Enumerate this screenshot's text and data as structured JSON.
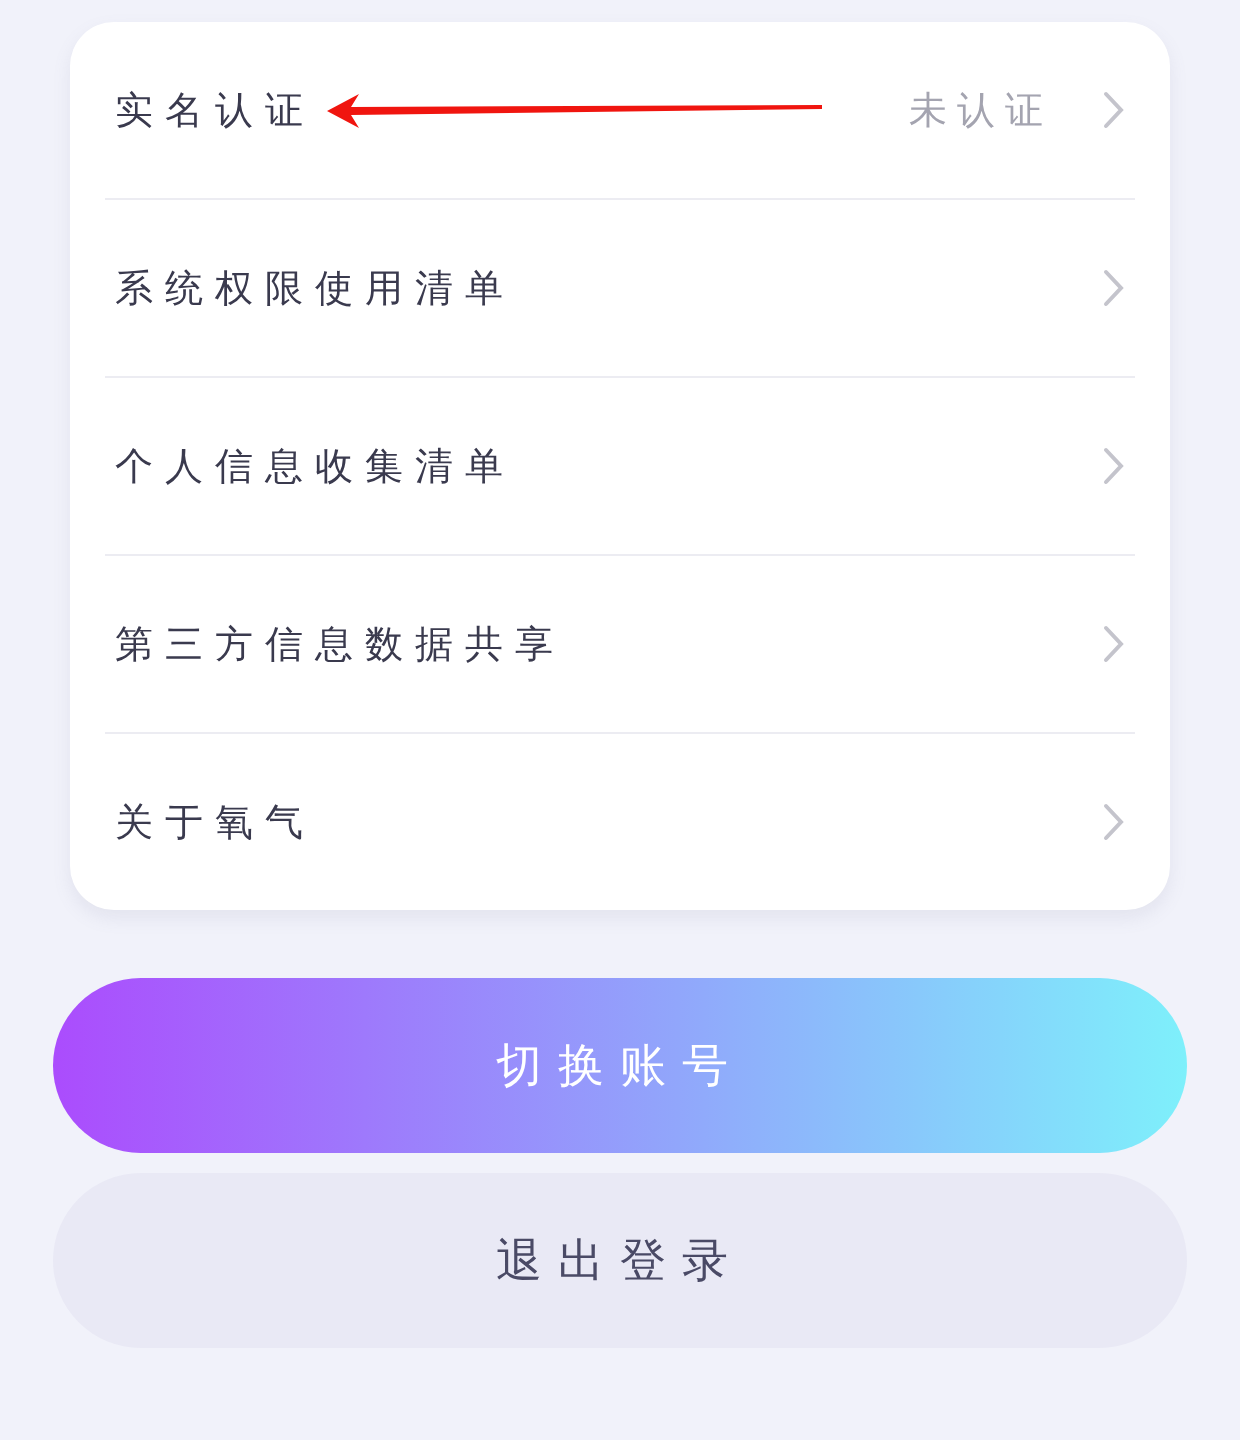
{
  "settings": [
    {
      "label": "实名认证",
      "value": "未认证",
      "annotated": true
    },
    {
      "label": "系统权限使用清单",
      "annotated": false
    },
    {
      "label": "个人信息收集清单",
      "annotated": false
    },
    {
      "label": "第三方信息数据共享",
      "annotated": false
    },
    {
      "label": "关于氧气",
      "annotated": false
    }
  ],
  "buttons": [
    {
      "label": "切换账号",
      "kind": "primary"
    },
    {
      "label": "退出登录",
      "kind": "secondary"
    }
  ]
}
